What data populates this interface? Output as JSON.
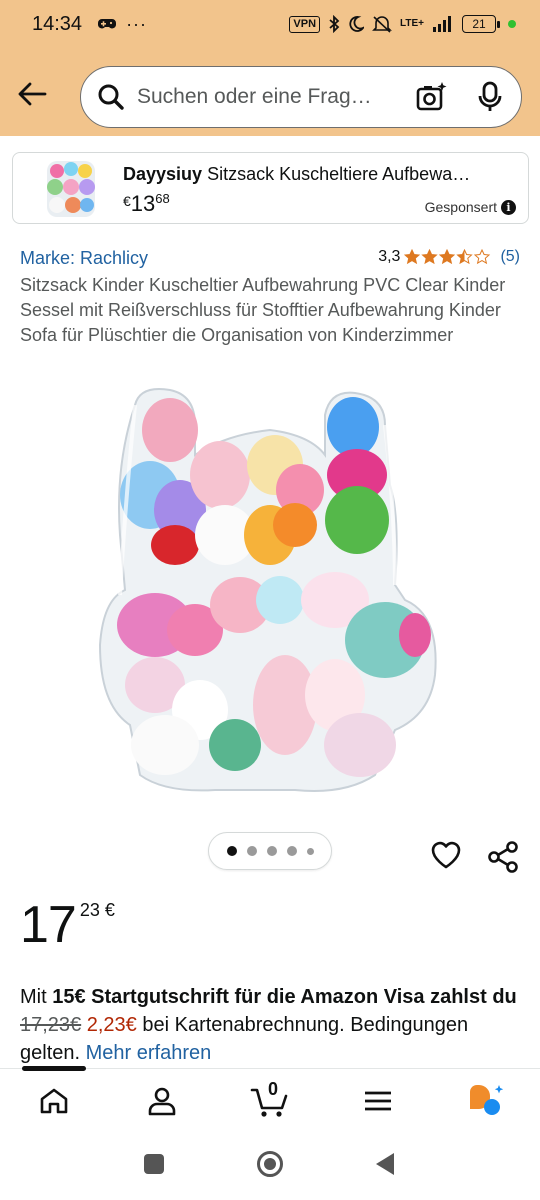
{
  "status_bar": {
    "time": "14:34",
    "left_icons": [
      "gamepad-icon",
      "more-icon"
    ],
    "vpn": "VPN",
    "network": "LTE+",
    "battery": "21"
  },
  "header": {
    "search_placeholder": "Suchen oder eine Frag…"
  },
  "sponsored": {
    "brand": "Dayysiuy",
    "title_rest": "Sitzsack Kuscheltiere Aufbewa…",
    "price_currency": "€",
    "price_whole": "13",
    "price_cents": "68",
    "label": "Gesponsert",
    "info": "i"
  },
  "product": {
    "brand_link": "Marke: Rachlicy",
    "rating_value": "3,3",
    "rating_stars": 3.5,
    "rating_count": "(5)",
    "title": "Sitzsack Kinder Kuscheltier Aufbewahrung PVC Clear Kinder Sessel mit Reißverschluss für Stofftier Aufbewahrung Kinder Sofa für Plüschtier die Organisation von Kinderzimmer",
    "image_count": 5,
    "active_image": 0,
    "price_whole": "17",
    "price_fraction": "23 €"
  },
  "promo": {
    "prefix": "Mit ",
    "bold": "15€ Startgutschrift für die Amazon Visa zahlst du",
    "old_price": "17,23€",
    "new_price": "2,23€",
    "suffix": " bei Kartenabrechnung. Bedingungen gelten. ",
    "link": "Mehr erfahren"
  },
  "bottom_nav": {
    "items": [
      "home-icon",
      "account-icon",
      "cart-icon",
      "menu-icon",
      "rufus-icon"
    ],
    "cart_count": "0"
  },
  "colors": {
    "header_bg": "#f2c48c",
    "link": "#2162a1",
    "star": "#de7921",
    "deal_red": "#b12704",
    "rufus_orange": "#f08c2b",
    "rufus_blue": "#1a8cf0"
  }
}
